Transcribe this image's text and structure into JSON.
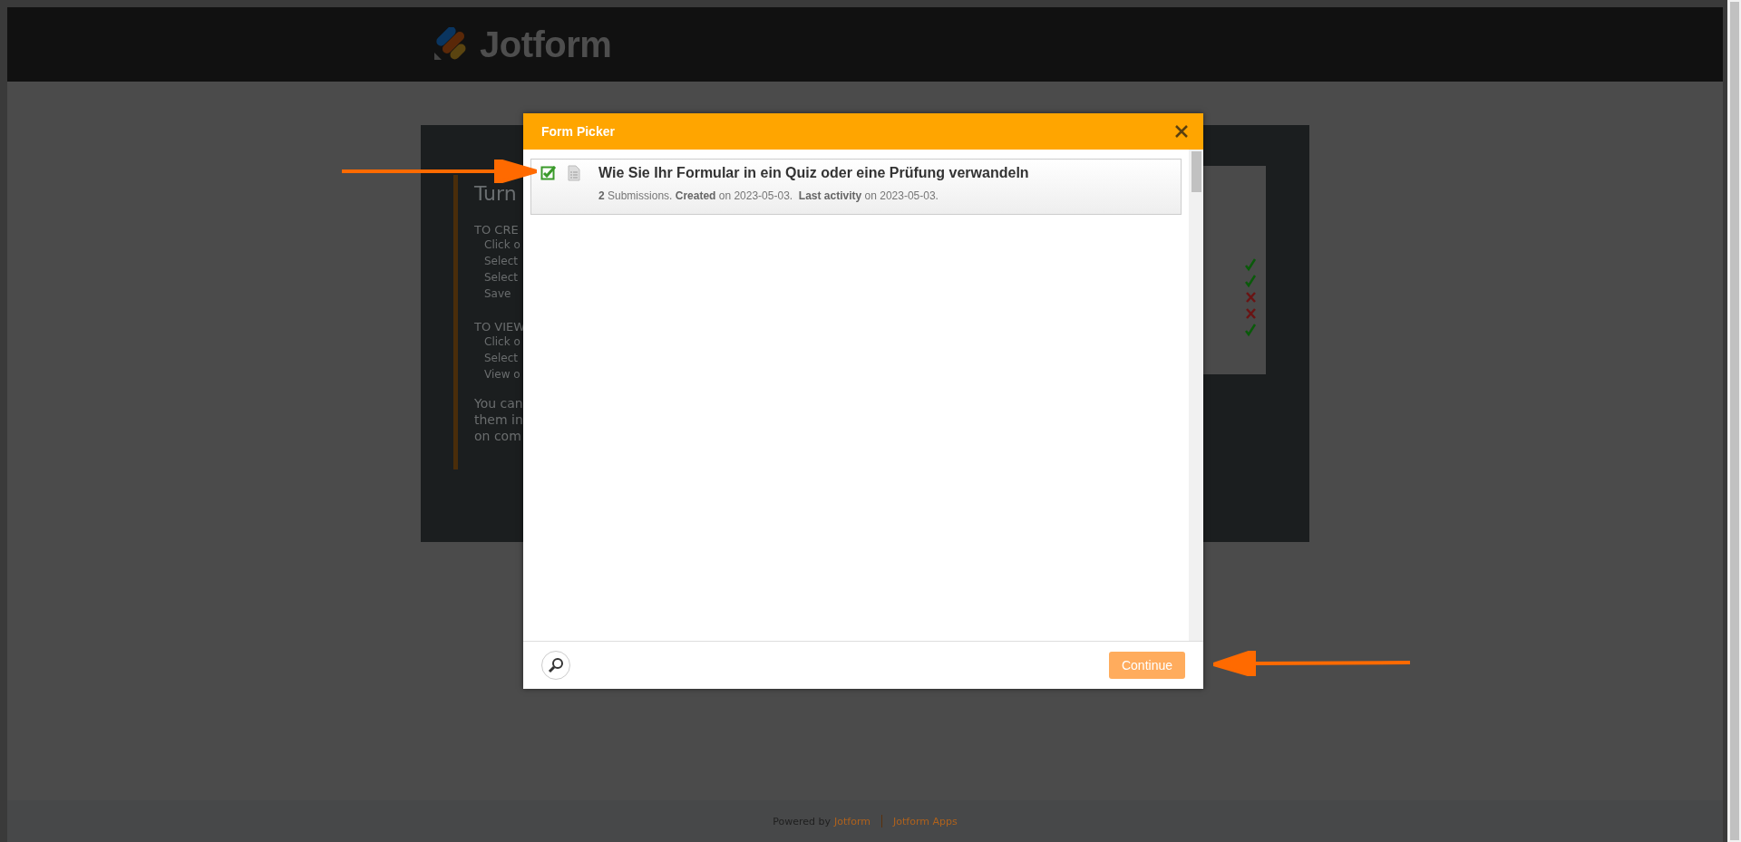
{
  "header": {
    "logo": "Jotform"
  },
  "background": {
    "title": "Turn",
    "sections": [
      {
        "heading": "TO CRE",
        "steps": [
          "Click o",
          "Select",
          "Select",
          "Save"
        ]
      },
      {
        "heading": "TO VIEW",
        "steps": [
          "Click o",
          "Select",
          "View o"
        ]
      }
    ],
    "note_lines": [
      "You can",
      "them in",
      "on com"
    ],
    "preview_marks": [
      {
        "kind": "check"
      },
      {
        "kind": "check"
      },
      {
        "kind": "cross"
      },
      {
        "kind": "cross"
      },
      {
        "kind": "check"
      }
    ]
  },
  "dialog": {
    "title": "Form Picker",
    "forms": [
      {
        "title": "Wie Sie Ihr Formular in ein Quiz oder eine Prüfung verwandeln",
        "meta": "**2** Submissions. **Created** on 2023-05-03.  **Last activity** on 2023-05-03.",
        "checked": true
      }
    ],
    "button": "Continue"
  },
  "footer": {
    "powered_prefix": "Powered by",
    "powered_brand": "Jotform",
    "apps_link": "Jotform Apps"
  }
}
